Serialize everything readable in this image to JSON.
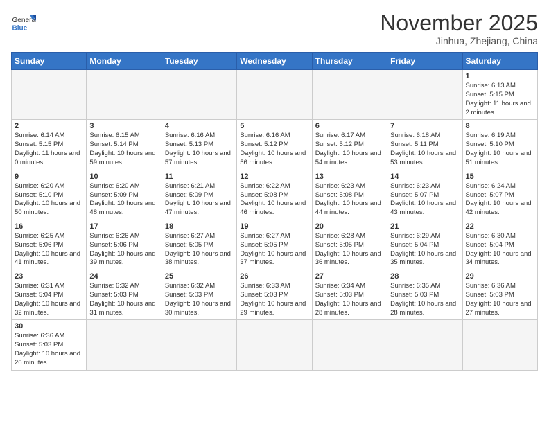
{
  "logo": {
    "text_general": "General",
    "text_blue": "Blue"
  },
  "header": {
    "month_title": "November 2025",
    "location": "Jinhua, Zhejiang, China"
  },
  "weekdays": [
    "Sunday",
    "Monday",
    "Tuesday",
    "Wednesday",
    "Thursday",
    "Friday",
    "Saturday"
  ],
  "weeks": [
    [
      {
        "day": "",
        "empty": true
      },
      {
        "day": "",
        "empty": true
      },
      {
        "day": "",
        "empty": true
      },
      {
        "day": "",
        "empty": true
      },
      {
        "day": "",
        "empty": true
      },
      {
        "day": "",
        "empty": true
      },
      {
        "day": "1",
        "sunrise": "6:13 AM",
        "sunset": "5:15 PM",
        "daylight": "11 hours and 2 minutes."
      }
    ],
    [
      {
        "day": "2",
        "sunrise": "6:14 AM",
        "sunset": "5:15 PM",
        "daylight": "11 hours and 0 minutes."
      },
      {
        "day": "3",
        "sunrise": "6:15 AM",
        "sunset": "5:14 PM",
        "daylight": "10 hours and 59 minutes."
      },
      {
        "day": "4",
        "sunrise": "6:16 AM",
        "sunset": "5:13 PM",
        "daylight": "10 hours and 57 minutes."
      },
      {
        "day": "5",
        "sunrise": "6:16 AM",
        "sunset": "5:12 PM",
        "daylight": "10 hours and 56 minutes."
      },
      {
        "day": "6",
        "sunrise": "6:17 AM",
        "sunset": "5:12 PM",
        "daylight": "10 hours and 54 minutes."
      },
      {
        "day": "7",
        "sunrise": "6:18 AM",
        "sunset": "5:11 PM",
        "daylight": "10 hours and 53 minutes."
      },
      {
        "day": "8",
        "sunrise": "6:19 AM",
        "sunset": "5:10 PM",
        "daylight": "10 hours and 51 minutes."
      }
    ],
    [
      {
        "day": "9",
        "sunrise": "6:20 AM",
        "sunset": "5:10 PM",
        "daylight": "10 hours and 50 minutes."
      },
      {
        "day": "10",
        "sunrise": "6:20 AM",
        "sunset": "5:09 PM",
        "daylight": "10 hours and 48 minutes."
      },
      {
        "day": "11",
        "sunrise": "6:21 AM",
        "sunset": "5:09 PM",
        "daylight": "10 hours and 47 minutes."
      },
      {
        "day": "12",
        "sunrise": "6:22 AM",
        "sunset": "5:08 PM",
        "daylight": "10 hours and 46 minutes."
      },
      {
        "day": "13",
        "sunrise": "6:23 AM",
        "sunset": "5:08 PM",
        "daylight": "10 hours and 44 minutes."
      },
      {
        "day": "14",
        "sunrise": "6:23 AM",
        "sunset": "5:07 PM",
        "daylight": "10 hours and 43 minutes."
      },
      {
        "day": "15",
        "sunrise": "6:24 AM",
        "sunset": "5:07 PM",
        "daylight": "10 hours and 42 minutes."
      }
    ],
    [
      {
        "day": "16",
        "sunrise": "6:25 AM",
        "sunset": "5:06 PM",
        "daylight": "10 hours and 41 minutes."
      },
      {
        "day": "17",
        "sunrise": "6:26 AM",
        "sunset": "5:06 PM",
        "daylight": "10 hours and 39 minutes."
      },
      {
        "day": "18",
        "sunrise": "6:27 AM",
        "sunset": "5:05 PM",
        "daylight": "10 hours and 38 minutes."
      },
      {
        "day": "19",
        "sunrise": "6:27 AM",
        "sunset": "5:05 PM",
        "daylight": "10 hours and 37 minutes."
      },
      {
        "day": "20",
        "sunrise": "6:28 AM",
        "sunset": "5:05 PM",
        "daylight": "10 hours and 36 minutes."
      },
      {
        "day": "21",
        "sunrise": "6:29 AM",
        "sunset": "5:04 PM",
        "daylight": "10 hours and 35 minutes."
      },
      {
        "day": "22",
        "sunrise": "6:30 AM",
        "sunset": "5:04 PM",
        "daylight": "10 hours and 34 minutes."
      }
    ],
    [
      {
        "day": "23",
        "sunrise": "6:31 AM",
        "sunset": "5:04 PM",
        "daylight": "10 hours and 32 minutes."
      },
      {
        "day": "24",
        "sunrise": "6:32 AM",
        "sunset": "5:03 PM",
        "daylight": "10 hours and 31 minutes."
      },
      {
        "day": "25",
        "sunrise": "6:32 AM",
        "sunset": "5:03 PM",
        "daylight": "10 hours and 30 minutes."
      },
      {
        "day": "26",
        "sunrise": "6:33 AM",
        "sunset": "5:03 PM",
        "daylight": "10 hours and 29 minutes."
      },
      {
        "day": "27",
        "sunrise": "6:34 AM",
        "sunset": "5:03 PM",
        "daylight": "10 hours and 28 minutes."
      },
      {
        "day": "28",
        "sunrise": "6:35 AM",
        "sunset": "5:03 PM",
        "daylight": "10 hours and 28 minutes."
      },
      {
        "day": "29",
        "sunrise": "6:36 AM",
        "sunset": "5:03 PM",
        "daylight": "10 hours and 27 minutes."
      }
    ],
    [
      {
        "day": "30",
        "sunrise": "6:36 AM",
        "sunset": "5:03 PM",
        "daylight": "10 hours and 26 minutes."
      },
      {
        "day": "",
        "empty": true
      },
      {
        "day": "",
        "empty": true
      },
      {
        "day": "",
        "empty": true
      },
      {
        "day": "",
        "empty": true
      },
      {
        "day": "",
        "empty": true
      },
      {
        "day": "",
        "empty": true
      }
    ]
  ]
}
